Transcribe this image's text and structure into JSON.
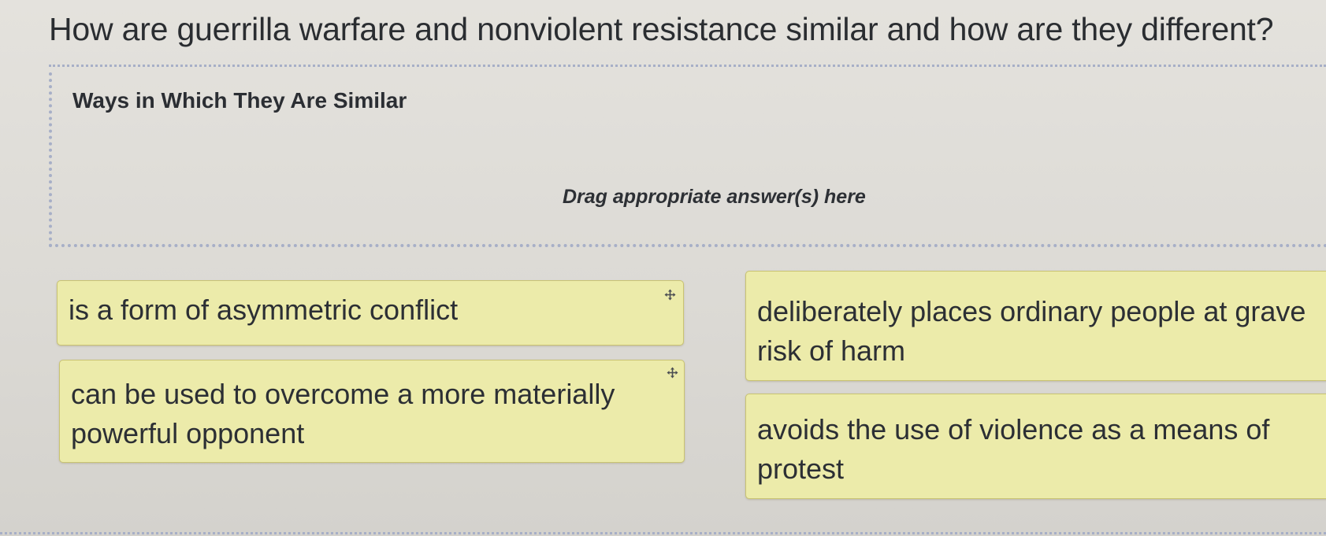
{
  "question": "How are guerrilla warfare and nonviolent resistance similar and how are they different?",
  "drop_zone": {
    "title": "Ways in Which They Are Similar",
    "hint": "Drag appropriate answer(s) here"
  },
  "answer_cards": [
    {
      "text": "is a form of asymmetric conflict",
      "icon": "move-icon"
    },
    {
      "text": "can be used to overcome a more materially powerful opponent",
      "icon": "move-icon"
    },
    {
      "text": "deliberately places ordinary people at grave risk of harm"
    },
    {
      "text": "avoids the use of violence as a means of protest"
    }
  ],
  "colors": {
    "card_fill": "#ecebaa",
    "card_border": "#c9c372",
    "dotted_border": "#a7afc7",
    "text": "#2c2f34",
    "page_background": "#e4e2dd"
  }
}
